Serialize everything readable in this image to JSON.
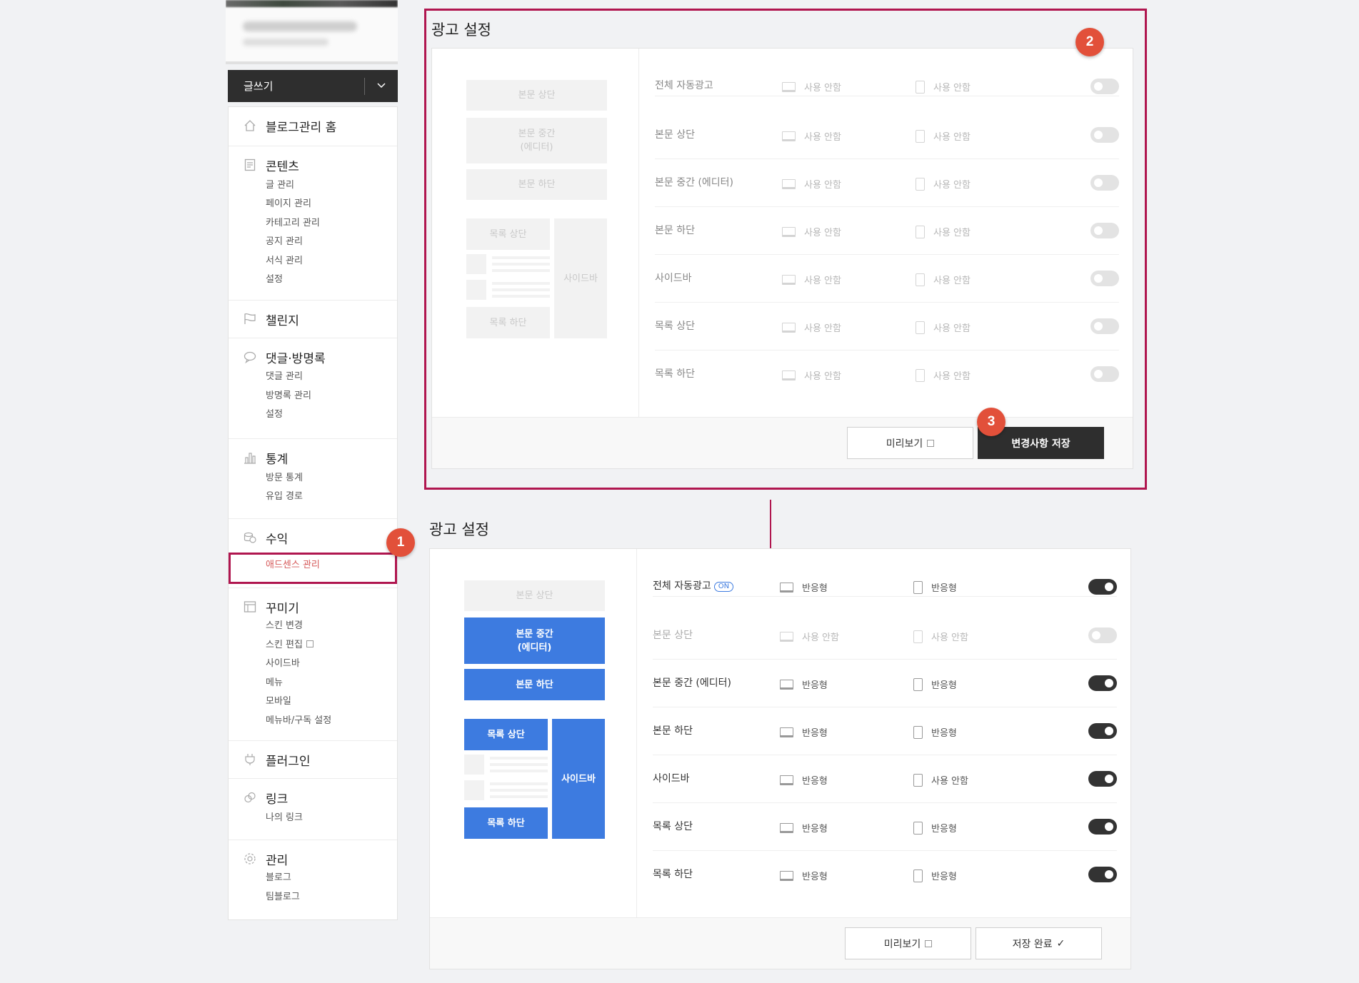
{
  "sidebar": {
    "write_label": "글쓰기",
    "groups": [
      {
        "title": "블로그관리 홈",
        "icon": "home-icon",
        "items": []
      },
      {
        "title": "콘텐츠",
        "icon": "document-icon",
        "items": [
          "글 관리",
          "페이지 관리",
          "카테고리 관리",
          "공지 관리",
          "서식 관리",
          "설정"
        ]
      },
      {
        "title": "챌린지",
        "icon": "flag-icon",
        "items": []
      },
      {
        "title": "댓글·방명록",
        "icon": "speech-bubble-icon",
        "items": [
          "댓글 관리",
          "방명록 관리",
          "설정"
        ]
      },
      {
        "title": "통계",
        "icon": "bar-chart-icon",
        "items": [
          "방문 통계",
          "유입 경로"
        ]
      },
      {
        "title": "수익",
        "icon": "coins-icon",
        "items": [
          "애드센스 관리"
        ]
      },
      {
        "title": "꾸미기",
        "icon": "layout-icon",
        "items": [
          "스킨 변경",
          "스킨 편집",
          "사이드바",
          "메뉴",
          "모바일",
          "메뉴바/구독 설정"
        ]
      },
      {
        "title": "플러그인",
        "icon": "plug-icon",
        "items": []
      },
      {
        "title": "링크",
        "icon": "link-icon",
        "items": [
          "나의 링크"
        ]
      },
      {
        "title": "관리",
        "icon": "gear-icon",
        "items": [
          "블로그",
          "팀블로그"
        ]
      }
    ]
  },
  "badges": [
    "1",
    "2",
    "3"
  ],
  "before": {
    "title": "광고 설정",
    "preview_blocks": {
      "body_top": "본문 상단",
      "body_mid": "본문 중간\n(에디터)",
      "body_bottom": "본문 하단",
      "list_top": "목록 상단",
      "list_bottom": "목록 하단",
      "sidebar": "사이드바"
    },
    "rows": [
      {
        "name": "전체 자동광고",
        "pc": "사용 안함",
        "mobile": "사용 안함",
        "on": false
      },
      {
        "name": "본문 상단",
        "pc": "사용 안함",
        "mobile": "사용 안함",
        "on": false
      },
      {
        "name": "본문 중간 (에디터)",
        "pc": "사용 안함",
        "mobile": "사용 안함",
        "on": false
      },
      {
        "name": "본문 하단",
        "pc": "사용 안함",
        "mobile": "사용 안함",
        "on": false
      },
      {
        "name": "사이드바",
        "pc": "사용 안함",
        "mobile": "사용 안함",
        "on": false
      },
      {
        "name": "목록 상단",
        "pc": "사용 안함",
        "mobile": "사용 안함",
        "on": false
      },
      {
        "name": "목록 하단",
        "pc": "사용 안함",
        "mobile": "사용 안함",
        "on": false
      }
    ],
    "preview_button": "미리보기",
    "save_button": "변경사항 저장"
  },
  "after": {
    "title": "광고 설정",
    "on_tag": "ON",
    "preview_blocks": {
      "body_top": "본문 상단",
      "body_mid": "본문 중간\n(에디터)",
      "body_bottom": "본문 하단",
      "list_top": "목록 상단",
      "list_bottom": "목록 하단",
      "sidebar": "사이드바"
    },
    "rows": [
      {
        "name": "전체 자동광고",
        "pc": "반응형",
        "mobile": "반응형",
        "on": true
      },
      {
        "name": "본문 상단",
        "pc": "사용 안함",
        "mobile": "사용 안함",
        "on": false
      },
      {
        "name": "본문 중간 (에디터)",
        "pc": "반응형",
        "mobile": "반응형",
        "on": true
      },
      {
        "name": "본문 하단",
        "pc": "반응형",
        "mobile": "반응형",
        "on": true
      },
      {
        "name": "사이드바",
        "pc": "반응형",
        "mobile": "사용 안함",
        "on": true
      },
      {
        "name": "목록 상단",
        "pc": "반응형",
        "mobile": "반응형",
        "on": true
      },
      {
        "name": "목록 하단",
        "pc": "반응형",
        "mobile": "반응형",
        "on": true
      }
    ],
    "preview_button": "미리보기",
    "saved_button": "저장 완료"
  },
  "colors": {
    "accent_blue": "#3d7be0",
    "highlight": "#b0164f",
    "badge": "#e2503a",
    "active_menu": "#d65a5a"
  }
}
